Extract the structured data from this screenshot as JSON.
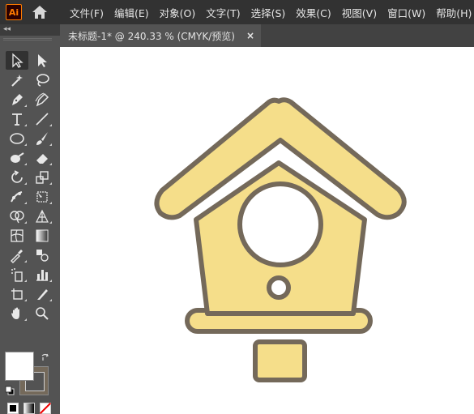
{
  "app": {
    "logo_text": "Ai",
    "accent": "#ff7c00"
  },
  "menu": {
    "items": [
      {
        "label": "文件(F)"
      },
      {
        "label": "编辑(E)"
      },
      {
        "label": "对象(O)"
      },
      {
        "label": "文字(T)"
      },
      {
        "label": "选择(S)"
      },
      {
        "label": "效果(C)"
      },
      {
        "label": "视图(V)"
      },
      {
        "label": "窗口(W)"
      },
      {
        "label": "帮助(H)"
      }
    ]
  },
  "panel": {
    "collapse_label": "◂◂"
  },
  "document": {
    "tab_title": "未标题-1* @ 240.33 % (CMYK/预览)",
    "close_glyph": "×"
  },
  "tools": [
    "selection-tool",
    "direct-selection-tool",
    "magic-wand-tool",
    "lasso-tool",
    "pen-tool",
    "curvature-tool",
    "type-tool",
    "line-tool",
    "ellipse-tool",
    "paintbrush-tool",
    "shaper-tool",
    "eraser-tool",
    "rotate-tool",
    "scale-tool",
    "puppet-warp-tool",
    "free-transform-tool",
    "shape-builder-tool",
    "perspective-grid-tool",
    "mesh-tool",
    "gradient-tool",
    "eyedropper-tool",
    "blend-tool",
    "symbol-sprayer-tool",
    "column-graph-tool",
    "artboard-tool",
    "slice-tool",
    "hand-tool",
    "zoom-tool"
  ],
  "colors": {
    "fill": "#ffffff",
    "stroke": "#74695a",
    "art_fill": "#f5de8a",
    "art_stroke": "#74695a",
    "hole_fill": "#ffffff"
  }
}
